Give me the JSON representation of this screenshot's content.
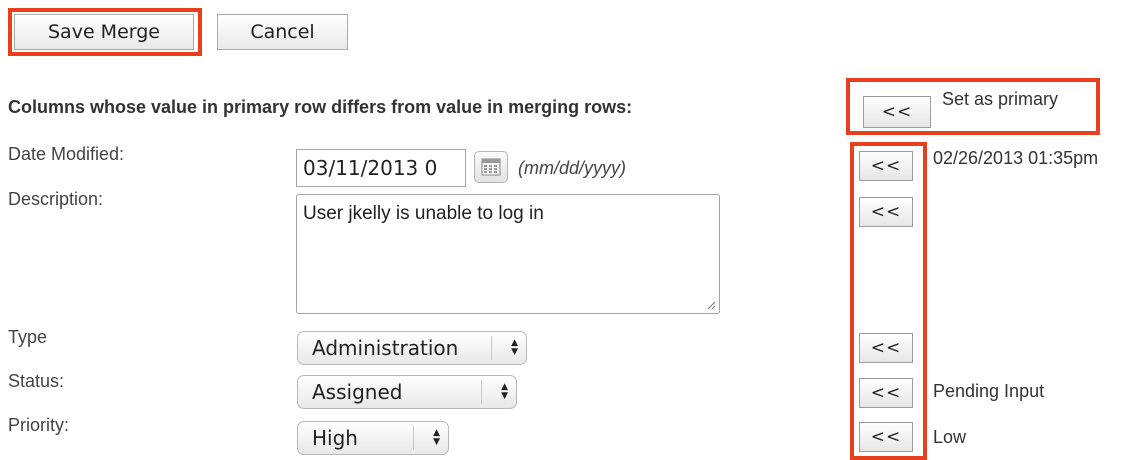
{
  "toolbar": {
    "save_label": "Save Merge",
    "cancel_label": "Cancel"
  },
  "section": {
    "heading": "Columns whose value in primary row differs from value in merging rows:",
    "set_primary_button": "<<",
    "set_primary_label": "Set as primary"
  },
  "fields": {
    "date_modified": {
      "label": "Date Modified:",
      "value": "03/11/2013 0",
      "format_hint": "(mm/dd/yyyy)",
      "copy_button": "<<",
      "merge_value": "02/26/2013 01:35pm"
    },
    "description": {
      "label": "Description:",
      "value": "User jkelly is unable to log in",
      "copy_button": "<<",
      "merge_value": ""
    },
    "type": {
      "label": "Type",
      "value": "Administration",
      "copy_button": "<<",
      "merge_value": ""
    },
    "status": {
      "label": "Status:",
      "value": "Assigned",
      "copy_button": "<<",
      "merge_value": "Pending Input"
    },
    "priority": {
      "label": "Priority:",
      "value": "High",
      "copy_button": "<<",
      "merge_value": "Low"
    }
  },
  "icons": {
    "calendar": "calendar-icon",
    "select_arrows": "up-down-arrows-icon",
    "resize": "resize-handle-icon"
  },
  "colors": {
    "highlight": "#e8401f"
  }
}
